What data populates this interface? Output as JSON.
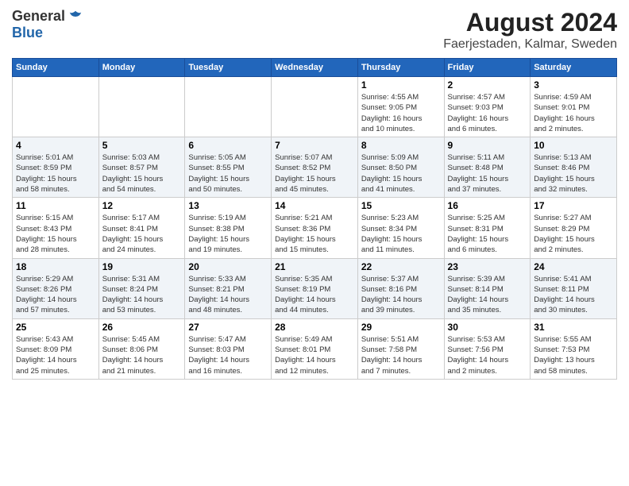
{
  "header": {
    "logo_general": "General",
    "logo_blue": "Blue",
    "month": "August 2024",
    "location": "Faerjestaden, Kalmar, Sweden"
  },
  "days_of_week": [
    "Sunday",
    "Monday",
    "Tuesday",
    "Wednesday",
    "Thursday",
    "Friday",
    "Saturday"
  ],
  "weeks": [
    [
      {
        "day": "",
        "info": ""
      },
      {
        "day": "",
        "info": ""
      },
      {
        "day": "",
        "info": ""
      },
      {
        "day": "",
        "info": ""
      },
      {
        "day": "1",
        "info": "Sunrise: 4:55 AM\nSunset: 9:05 PM\nDaylight: 16 hours\nand 10 minutes."
      },
      {
        "day": "2",
        "info": "Sunrise: 4:57 AM\nSunset: 9:03 PM\nDaylight: 16 hours\nand 6 minutes."
      },
      {
        "day": "3",
        "info": "Sunrise: 4:59 AM\nSunset: 9:01 PM\nDaylight: 16 hours\nand 2 minutes."
      }
    ],
    [
      {
        "day": "4",
        "info": "Sunrise: 5:01 AM\nSunset: 8:59 PM\nDaylight: 15 hours\nand 58 minutes."
      },
      {
        "day": "5",
        "info": "Sunrise: 5:03 AM\nSunset: 8:57 PM\nDaylight: 15 hours\nand 54 minutes."
      },
      {
        "day": "6",
        "info": "Sunrise: 5:05 AM\nSunset: 8:55 PM\nDaylight: 15 hours\nand 50 minutes."
      },
      {
        "day": "7",
        "info": "Sunrise: 5:07 AM\nSunset: 8:52 PM\nDaylight: 15 hours\nand 45 minutes."
      },
      {
        "day": "8",
        "info": "Sunrise: 5:09 AM\nSunset: 8:50 PM\nDaylight: 15 hours\nand 41 minutes."
      },
      {
        "day": "9",
        "info": "Sunrise: 5:11 AM\nSunset: 8:48 PM\nDaylight: 15 hours\nand 37 minutes."
      },
      {
        "day": "10",
        "info": "Sunrise: 5:13 AM\nSunset: 8:46 PM\nDaylight: 15 hours\nand 32 minutes."
      }
    ],
    [
      {
        "day": "11",
        "info": "Sunrise: 5:15 AM\nSunset: 8:43 PM\nDaylight: 15 hours\nand 28 minutes."
      },
      {
        "day": "12",
        "info": "Sunrise: 5:17 AM\nSunset: 8:41 PM\nDaylight: 15 hours\nand 24 minutes."
      },
      {
        "day": "13",
        "info": "Sunrise: 5:19 AM\nSunset: 8:38 PM\nDaylight: 15 hours\nand 19 minutes."
      },
      {
        "day": "14",
        "info": "Sunrise: 5:21 AM\nSunset: 8:36 PM\nDaylight: 15 hours\nand 15 minutes."
      },
      {
        "day": "15",
        "info": "Sunrise: 5:23 AM\nSunset: 8:34 PM\nDaylight: 15 hours\nand 11 minutes."
      },
      {
        "day": "16",
        "info": "Sunrise: 5:25 AM\nSunset: 8:31 PM\nDaylight: 15 hours\nand 6 minutes."
      },
      {
        "day": "17",
        "info": "Sunrise: 5:27 AM\nSunset: 8:29 PM\nDaylight: 15 hours\nand 2 minutes."
      }
    ],
    [
      {
        "day": "18",
        "info": "Sunrise: 5:29 AM\nSunset: 8:26 PM\nDaylight: 14 hours\nand 57 minutes."
      },
      {
        "day": "19",
        "info": "Sunrise: 5:31 AM\nSunset: 8:24 PM\nDaylight: 14 hours\nand 53 minutes."
      },
      {
        "day": "20",
        "info": "Sunrise: 5:33 AM\nSunset: 8:21 PM\nDaylight: 14 hours\nand 48 minutes."
      },
      {
        "day": "21",
        "info": "Sunrise: 5:35 AM\nSunset: 8:19 PM\nDaylight: 14 hours\nand 44 minutes."
      },
      {
        "day": "22",
        "info": "Sunrise: 5:37 AM\nSunset: 8:16 PM\nDaylight: 14 hours\nand 39 minutes."
      },
      {
        "day": "23",
        "info": "Sunrise: 5:39 AM\nSunset: 8:14 PM\nDaylight: 14 hours\nand 35 minutes."
      },
      {
        "day": "24",
        "info": "Sunrise: 5:41 AM\nSunset: 8:11 PM\nDaylight: 14 hours\nand 30 minutes."
      }
    ],
    [
      {
        "day": "25",
        "info": "Sunrise: 5:43 AM\nSunset: 8:09 PM\nDaylight: 14 hours\nand 25 minutes."
      },
      {
        "day": "26",
        "info": "Sunrise: 5:45 AM\nSunset: 8:06 PM\nDaylight: 14 hours\nand 21 minutes."
      },
      {
        "day": "27",
        "info": "Sunrise: 5:47 AM\nSunset: 8:03 PM\nDaylight: 14 hours\nand 16 minutes."
      },
      {
        "day": "28",
        "info": "Sunrise: 5:49 AM\nSunset: 8:01 PM\nDaylight: 14 hours\nand 12 minutes."
      },
      {
        "day": "29",
        "info": "Sunrise: 5:51 AM\nSunset: 7:58 PM\nDaylight: 14 hours\nand 7 minutes."
      },
      {
        "day": "30",
        "info": "Sunrise: 5:53 AM\nSunset: 7:56 PM\nDaylight: 14 hours\nand 2 minutes."
      },
      {
        "day": "31",
        "info": "Sunrise: 5:55 AM\nSunset: 7:53 PM\nDaylight: 13 hours\nand 58 minutes."
      }
    ]
  ]
}
